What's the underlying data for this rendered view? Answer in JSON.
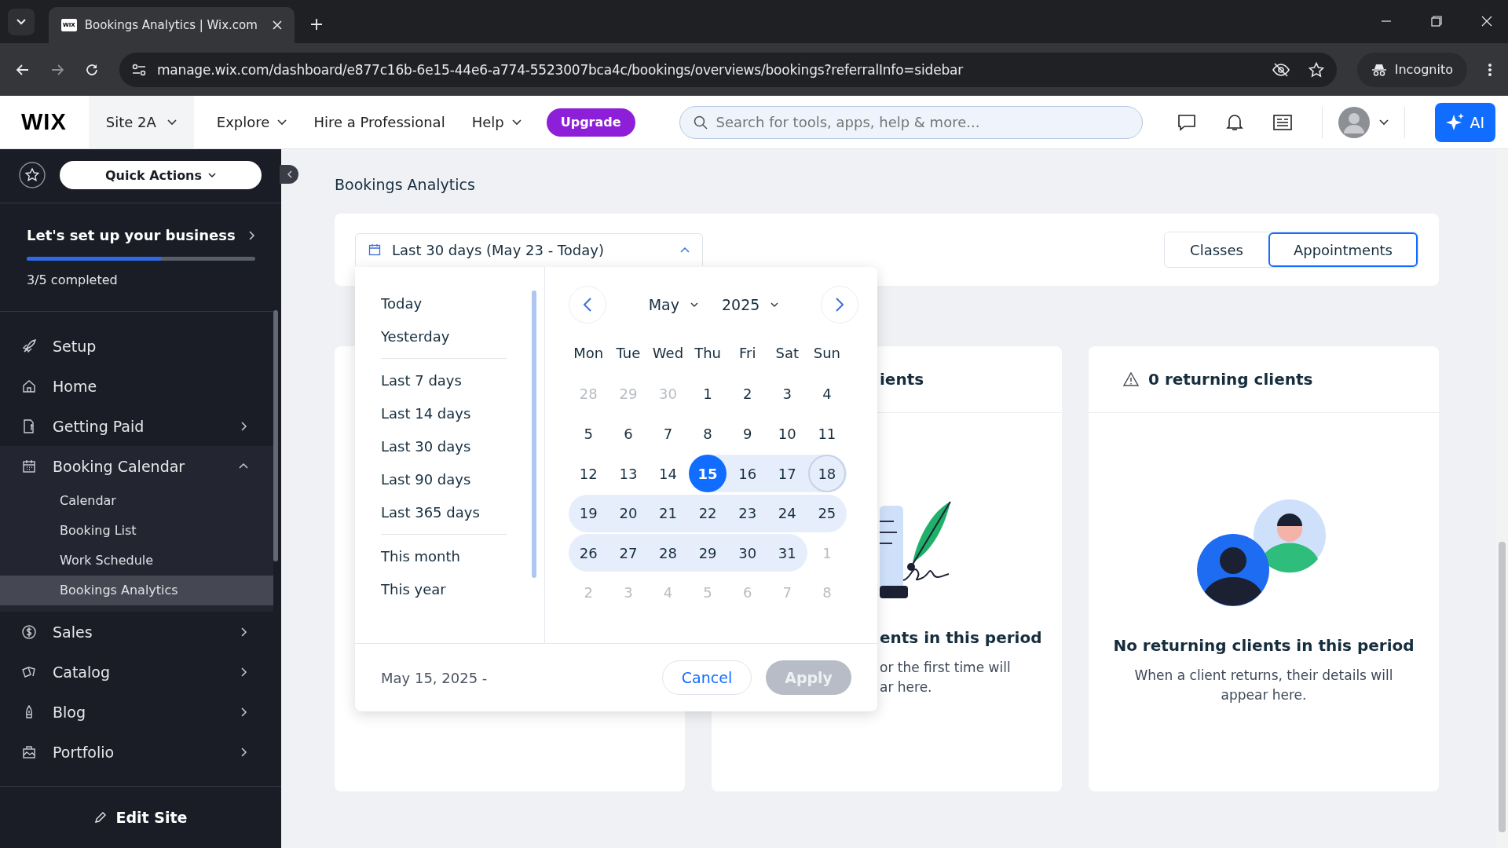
{
  "browser": {
    "tab_title": "Bookings Analytics | Wix.com",
    "tab_favicon": "WIX",
    "url": "manage.wix.com/dashboard/e877c16b-6e15-44e6-a774-5523007bca4c/bookings/overviews/bookings?referralInfo=sidebar",
    "incognito_label": "Incognito"
  },
  "header": {
    "logo": "WIX",
    "site": "Site 2A",
    "nav": [
      {
        "label": "Explore",
        "dropdown": true
      },
      {
        "label": "Hire a Professional",
        "dropdown": false
      },
      {
        "label": "Help",
        "dropdown": true
      }
    ],
    "upgrade": "Upgrade",
    "search": {
      "placeholder": "Search for tools, apps, help & more..."
    },
    "ai_button": "AI"
  },
  "sidebar": {
    "quick_actions": "Quick Actions",
    "setup_title": "Let's set up your business",
    "setup_progress": {
      "level": 0.59
    },
    "setup_count": "3/5 completed",
    "items": [
      {
        "label": "Setup",
        "has_arrow": false
      },
      {
        "label": "Home",
        "has_arrow": false
      },
      {
        "label": "Getting Paid",
        "has_arrow": true,
        "expanded": false
      },
      {
        "label": "Booking Calendar",
        "has_arrow": true,
        "expanded": true,
        "children": [
          {
            "label": "Calendar",
            "selected": false
          },
          {
            "label": "Booking List",
            "selected": false
          },
          {
            "label": "Work Schedule",
            "selected": false
          },
          {
            "label": "Bookings Analytics",
            "selected": true
          }
        ]
      },
      {
        "label": "Sales",
        "has_arrow": true,
        "expanded": false
      },
      {
        "label": "Catalog",
        "has_arrow": true,
        "expanded": false
      },
      {
        "label": "Blog",
        "has_arrow": true,
        "expanded": false
      },
      {
        "label": "Portfolio",
        "has_arrow": true,
        "expanded": false
      }
    ],
    "edit_site": "Edit Site"
  },
  "page": {
    "title": "Bookings Analytics",
    "date_filter": {
      "label": "Last 30 days (May 23 - Today)",
      "expanded": true
    },
    "view_tabs": [
      {
        "label": "Classes",
        "selected": false
      },
      {
        "label": "Appointments",
        "selected": true
      }
    ],
    "date_picker": {
      "presets": [
        [
          "Today",
          "Yesterday"
        ],
        [
          "Last 7 days",
          "Last 14 days",
          "Last 30 days",
          "Last 90 days",
          "Last 365 days"
        ],
        [
          "This month",
          "This year"
        ]
      ],
      "month": "May",
      "year": "2025",
      "weekdays": [
        "Mon",
        "Tue",
        "Wed",
        "Thu",
        "Fri",
        "Sat",
        "Sun"
      ],
      "weeks": [
        [
          {
            "day": "28",
            "outside": true
          },
          {
            "day": "29",
            "outside": true
          },
          {
            "day": "30",
            "outside": true
          },
          {
            "day": "1",
            "outside": false
          },
          {
            "day": "2",
            "outside": false
          },
          {
            "day": "3",
            "outside": false
          },
          {
            "day": "4",
            "outside": false
          }
        ],
        [
          {
            "day": "5",
            "outside": false
          },
          {
            "day": "6",
            "outside": false
          },
          {
            "day": "7",
            "outside": false
          },
          {
            "day": "8",
            "outside": false
          },
          {
            "day": "9",
            "outside": false
          },
          {
            "day": "10",
            "outside": false
          },
          {
            "day": "11",
            "outside": false
          }
        ],
        [
          {
            "day": "12",
            "outside": false
          },
          {
            "day": "13",
            "outside": false
          },
          {
            "day": "14",
            "outside": false
          },
          {
            "day": "15",
            "outside": false,
            "selected": true
          },
          {
            "day": "16",
            "outside": false,
            "in_range": true
          },
          {
            "day": "17",
            "outside": false,
            "in_range": true
          },
          {
            "day": "18",
            "outside": false,
            "in_range": true,
            "hovered": true
          }
        ],
        [
          {
            "day": "19",
            "outside": false,
            "in_range": true
          },
          {
            "day": "20",
            "outside": false,
            "in_range": true
          },
          {
            "day": "21",
            "outside": false,
            "in_range": true
          },
          {
            "day": "22",
            "outside": false,
            "in_range": true
          },
          {
            "day": "23",
            "outside": false,
            "in_range": true
          },
          {
            "day": "24",
            "outside": false,
            "in_range": true
          },
          {
            "day": "25",
            "outside": false,
            "in_range": true
          }
        ],
        [
          {
            "day": "26",
            "outside": false,
            "in_range": true
          },
          {
            "day": "27",
            "outside": false,
            "in_range": true
          },
          {
            "day": "28",
            "outside": false,
            "in_range": true
          },
          {
            "day": "29",
            "outside": false,
            "in_range": true
          },
          {
            "day": "30",
            "outside": false,
            "in_range": true
          },
          {
            "day": "31",
            "outside": false,
            "in_range": true
          },
          {
            "day": "1",
            "outside": true
          }
        ],
        [
          {
            "day": "2",
            "outside": true
          },
          {
            "day": "3",
            "outside": true
          },
          {
            "day": "4",
            "outside": true
          },
          {
            "day": "5",
            "outside": true
          },
          {
            "day": "6",
            "outside": true
          },
          {
            "day": "7",
            "outside": true
          },
          {
            "day": "8",
            "outside": true
          }
        ]
      ],
      "range_text": "May 15, 2025 -",
      "cancel": "Cancel",
      "apply": {
        "label": "Apply",
        "disabled": true
      }
    },
    "cards": [
      {
        "kind": "blank"
      },
      {
        "kind": "document",
        "title": "ients",
        "warning": false,
        "heading": "ents in this period",
        "text": [
          "or the first time will",
          "ar here."
        ]
      },
      {
        "kind": "people",
        "title": "0 returning clients",
        "warning": true,
        "heading": "No returning clients in this period",
        "text": [
          "When a client returns, their details will appear here."
        ]
      }
    ]
  }
}
